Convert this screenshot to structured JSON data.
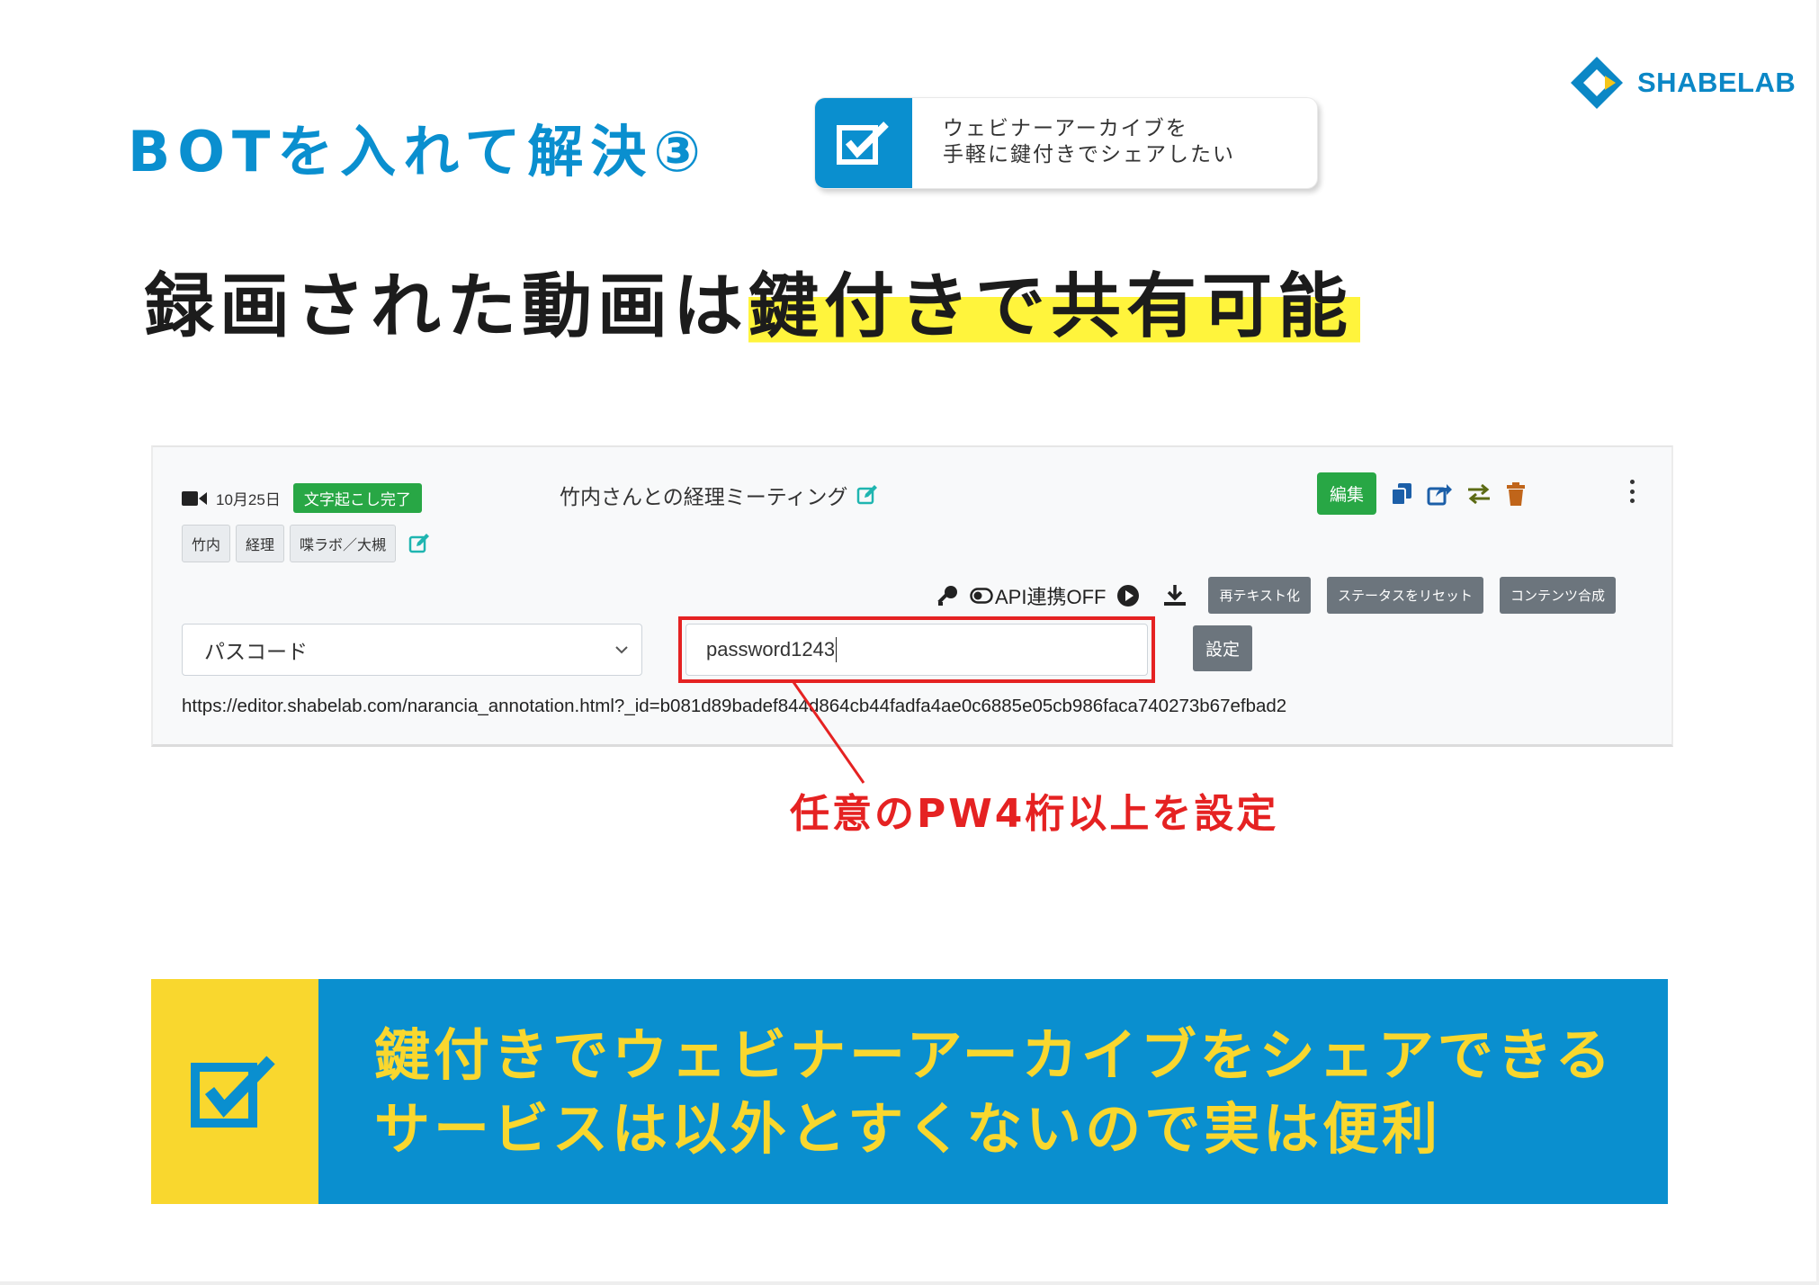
{
  "brand": {
    "logo_text": "SHABELAB",
    "colors": {
      "primary": "#0a8fcf",
      "accent_yellow": "#f9d72e",
      "highlight": "#fff43c",
      "alert_red": "#e52222",
      "success_green": "#28a745",
      "secondary_gray": "#6c757d"
    }
  },
  "header": {
    "section_title": "BOTを入れて解決③",
    "tag": {
      "icon": "checkbox-icon",
      "line1": "ウェビナーアーカイブを",
      "line2": "手軽に鍵付きでシェアしたい"
    }
  },
  "headline": {
    "plain": "録画された動画は",
    "highlight": "鍵付きで共有可能"
  },
  "app": {
    "recording": {
      "icon": "video-camera-icon",
      "date": "10月25日",
      "status_badge": "文字起こし完了",
      "title": "竹内さんとの経理ミーティング",
      "tags": [
        "竹内",
        "経理",
        "喋ラボ／大槻"
      ]
    },
    "actions": {
      "edit_label": "編集",
      "icons": [
        "copy-icon",
        "share-icon",
        "swap-icon",
        "trash-icon",
        "more-vertical-icon"
      ]
    },
    "toolbar": {
      "api_label": "API連携OFF",
      "icons": [
        "key-icon",
        "toggle-icon",
        "play-icon",
        "download-icon"
      ],
      "retext_label": "再テキスト化",
      "reset_status_label": "ステータスをリセット",
      "compose_label": "コンテンツ合成"
    },
    "share_form": {
      "select_value": "パスコード",
      "password_value": "password1243",
      "submit_label": "設定",
      "url": "https://editor.shabelab.com/narancia_annotation.html?_id=b081d89badef844d864cb44fadfa4ae0c6885e05cb986faca740273b67efbad2"
    }
  },
  "annotation": {
    "text": "任意のPW4桁以上を設定"
  },
  "banner": {
    "icon": "checkbox-icon",
    "line1": "鍵付きでウェビナーアーカイブをシェアできる",
    "line2": "サービスは以外とすくないので実は便利"
  }
}
